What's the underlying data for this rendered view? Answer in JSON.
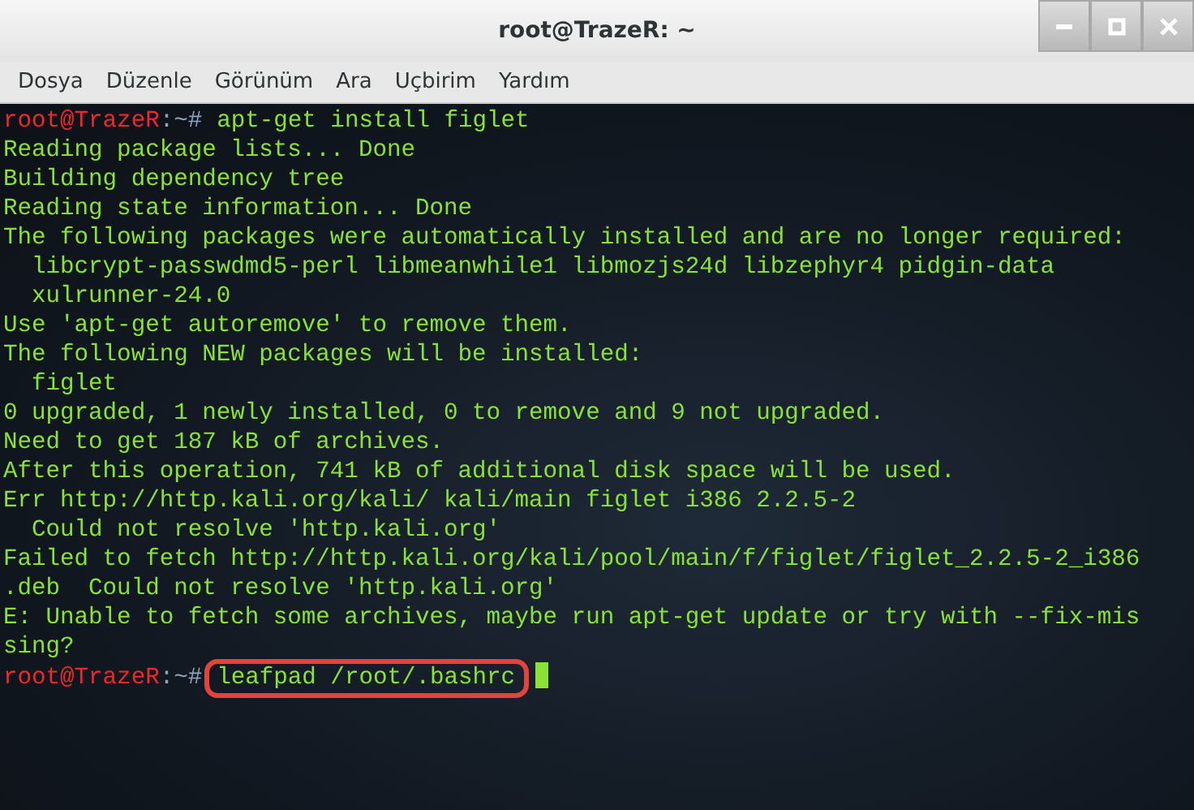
{
  "window": {
    "title": "root@TrazeR: ~"
  },
  "menu": [
    "Dosya",
    "Düzenle",
    "Görünüm",
    "Ara",
    "Uçbirim",
    "Yardım"
  ],
  "terminal": {
    "lines": [
      {
        "kind": "prompt",
        "host": "root@TrazeR",
        "suffix": ":~#",
        "command": "apt-get install figlet",
        "highlighted": false,
        "cursor": false
      },
      {
        "kind": "output",
        "text": "Reading package lists... Done"
      },
      {
        "kind": "output",
        "text": "Building dependency tree"
      },
      {
        "kind": "output",
        "text": "Reading state information... Done"
      },
      {
        "kind": "output",
        "text": "The following packages were automatically installed and are no longer required:"
      },
      {
        "kind": "output",
        "text": "  libcrypt-passwdmd5-perl libmeanwhile1 libmozjs24d libzephyr4 pidgin-data"
      },
      {
        "kind": "output",
        "text": "  xulrunner-24.0"
      },
      {
        "kind": "output",
        "text": "Use 'apt-get autoremove' to remove them."
      },
      {
        "kind": "output",
        "text": "The following NEW packages will be installed:"
      },
      {
        "kind": "output",
        "text": "  figlet"
      },
      {
        "kind": "output",
        "text": "0 upgraded, 1 newly installed, 0 to remove and 9 not upgraded."
      },
      {
        "kind": "output",
        "text": "Need to get 187 kB of archives."
      },
      {
        "kind": "output",
        "text": "After this operation, 741 kB of additional disk space will be used."
      },
      {
        "kind": "output",
        "text": "Err http://http.kali.org/kali/ kali/main figlet i386 2.2.5-2"
      },
      {
        "kind": "output",
        "text": "  Could not resolve 'http.kali.org'"
      },
      {
        "kind": "output",
        "text": "Failed to fetch http://http.kali.org/kali/pool/main/f/figlet/figlet_2.2.5-2_i386"
      },
      {
        "kind": "output",
        "text": ".deb  Could not resolve 'http.kali.org'"
      },
      {
        "kind": "output",
        "text": "E: Unable to fetch some archives, maybe run apt-get update or try with --fix-mis"
      },
      {
        "kind": "output",
        "text": "sing?"
      },
      {
        "kind": "prompt",
        "host": "root@TrazeR",
        "suffix": ":~#",
        "command": "leafpad /root/.bashrc",
        "highlighted": true,
        "cursor": true
      }
    ]
  }
}
